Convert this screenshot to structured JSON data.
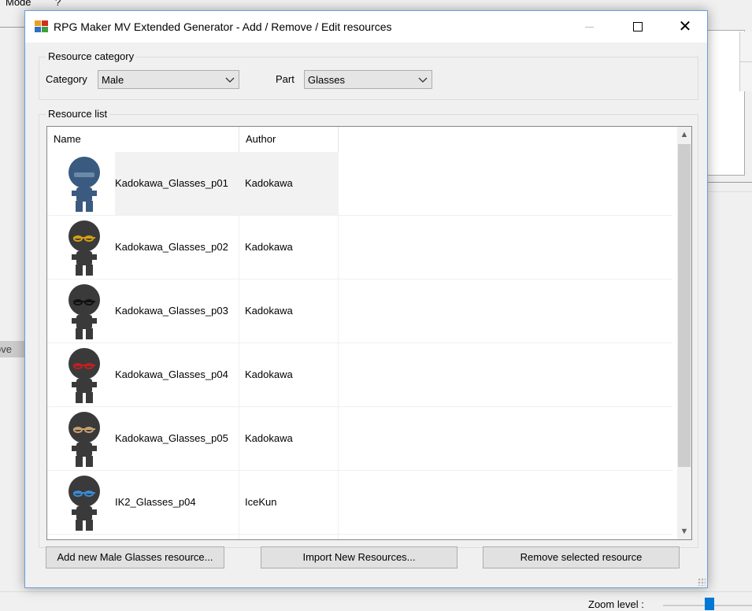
{
  "background_app": {
    "menu": [
      "Mode",
      "?"
    ],
    "left_button_label": "ove",
    "zoom_label": "Zoom level :"
  },
  "dialog": {
    "title": "RPG Maker MV Extended Generator - Add / Remove / Edit resources",
    "window_buttons": {
      "minimize": "minimize-icon",
      "maximize": "maximize-icon",
      "close": "✕"
    },
    "resource_category": {
      "label": "Resource category",
      "category_label": "Category",
      "category_value": "Male",
      "part_label": "Part",
      "part_value": "Glasses"
    },
    "resource_list": {
      "label": "Resource list",
      "columns": {
        "name": "Name",
        "author": "Author"
      },
      "rows": [
        {
          "name": "Kadokawa_Glasses_p01",
          "author": "Kadokawa",
          "sprite": "blue-silhouette",
          "selected": true
        },
        {
          "name": "Kadokawa_Glasses_p02",
          "author": "Kadokawa",
          "sprite": "gold-chain-glasses"
        },
        {
          "name": "Kadokawa_Glasses_p03",
          "author": "Kadokawa",
          "sprite": "black-glasses"
        },
        {
          "name": "Kadokawa_Glasses_p04",
          "author": "Kadokawa",
          "sprite": "red-glasses"
        },
        {
          "name": "Kadokawa_Glasses_p05",
          "author": "Kadokawa",
          "sprite": "tan-glasses"
        },
        {
          "name": "IK2_Glasses_p04",
          "author": "IceKun",
          "sprite": "blue-eye-glasses"
        }
      ]
    },
    "buttons": {
      "add": "Add new Male Glasses resource...",
      "import": "Import New Resources...",
      "remove": "Remove selected resource"
    }
  },
  "colors": {
    "accent": "#0078d7",
    "silhouette": "#3a3a3a",
    "selected_silhouette": "#3a5a80"
  }
}
